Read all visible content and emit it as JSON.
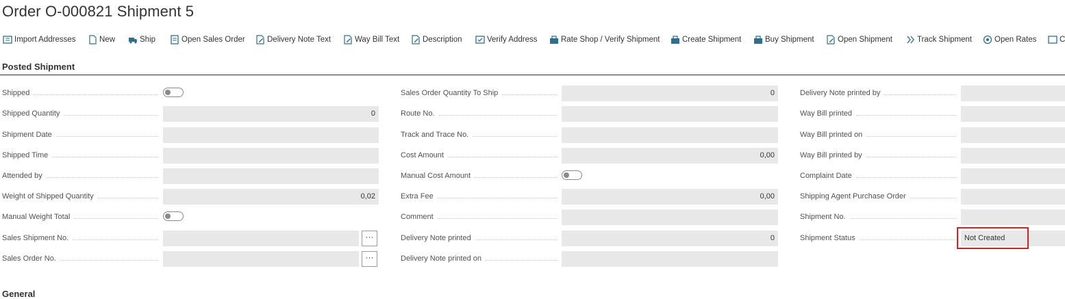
{
  "page": {
    "title": "Order O-000821 Shipment 5"
  },
  "toolbar": {
    "items": [
      {
        "label": "Import Addresses",
        "icon": "import-addresses-icon"
      },
      {
        "label": "New",
        "icon": "new-icon"
      },
      {
        "label": "Ship",
        "icon": "ship-icon"
      },
      {
        "label": "Open Sales Order",
        "icon": "open-sales-order-icon"
      },
      {
        "label": "Delivery Note Text",
        "icon": "edit-text-icon"
      },
      {
        "label": "Way Bill Text",
        "icon": "edit-text-icon"
      },
      {
        "label": "Description",
        "icon": "edit-text-icon"
      },
      {
        "label": "Verify Address",
        "icon": "verify-address-icon"
      },
      {
        "label": "Rate Shop / Verify Shipment",
        "icon": "rate-shop-icon"
      },
      {
        "label": "Create Shipment",
        "icon": "create-shipment-icon"
      },
      {
        "label": "Buy Shipment",
        "icon": "buy-shipment-icon"
      },
      {
        "label": "Open Shipment",
        "icon": "open-shipment-icon"
      },
      {
        "label": "Track Shipment",
        "icon": "track-shipment-icon"
      },
      {
        "label": "Open Rates",
        "icon": "open-rates-icon"
      },
      {
        "label": "C",
        "icon": "more-icon"
      }
    ]
  },
  "section": {
    "title": "Posted Shipment",
    "next_title": "General"
  },
  "col1": {
    "shipped": {
      "label": "Shipped",
      "value": false
    },
    "shipped_quantity": {
      "label": "Shipped Quantity",
      "value": "0"
    },
    "shipment_date": {
      "label": "Shipment Date",
      "value": ""
    },
    "shipped_time": {
      "label": "Shipped Time",
      "value": ""
    },
    "attended_by": {
      "label": "Attended by",
      "value": ""
    },
    "weight_shipped": {
      "label": "Weight of Shipped Quantity",
      "value": "0,02"
    },
    "manual_weight_total": {
      "label": "Manual Weight Total",
      "value": false
    },
    "sales_shipment_no": {
      "label": "Sales Shipment No.",
      "value": ""
    },
    "sales_order_no": {
      "label": "Sales Order No.",
      "value": ""
    },
    "lookup_label": "···"
  },
  "col2": {
    "so_qty_to_ship": {
      "label": "Sales Order Quantity To Ship",
      "value": "0"
    },
    "route_no": {
      "label": "Route No.",
      "value": ""
    },
    "track_trace_no": {
      "label": "Track and Trace No.",
      "value": ""
    },
    "cost_amount": {
      "label": "Cost Amount",
      "value": "0,00"
    },
    "manual_cost_amount": {
      "label": "Manual Cost Amount",
      "value": false
    },
    "extra_fee": {
      "label": "Extra Fee",
      "value": "0,00"
    },
    "comment": {
      "label": "Comment",
      "value": ""
    },
    "delivery_note_printed": {
      "label": "Delivery Note printed",
      "value": "0"
    },
    "delivery_note_printed_on": {
      "label": "Delivery Note printed on",
      "value": ""
    }
  },
  "col3": {
    "delivery_note_printed_by": {
      "label": "Delivery Note printed by",
      "value": ""
    },
    "way_bill_printed": {
      "label": "Way Bill printed",
      "value": ""
    },
    "way_bill_printed_on": {
      "label": "Way Bill printed on",
      "value": ""
    },
    "way_bill_printed_by": {
      "label": "Way Bill printed by",
      "value": ""
    },
    "complaint_date": {
      "label": "Complaint Date",
      "value": ""
    },
    "shipping_agent_po": {
      "label": "Shipping Agent Purchase Order",
      "value": ""
    },
    "shipment_no": {
      "label": "Shipment No.",
      "value": ""
    },
    "shipment_status": {
      "label": "Shipment Status",
      "value": "Not Created"
    }
  },
  "colors": {
    "field_bg": "#e8e8e8",
    "highlight": "#d02020",
    "divider": "#2b2b2b"
  }
}
